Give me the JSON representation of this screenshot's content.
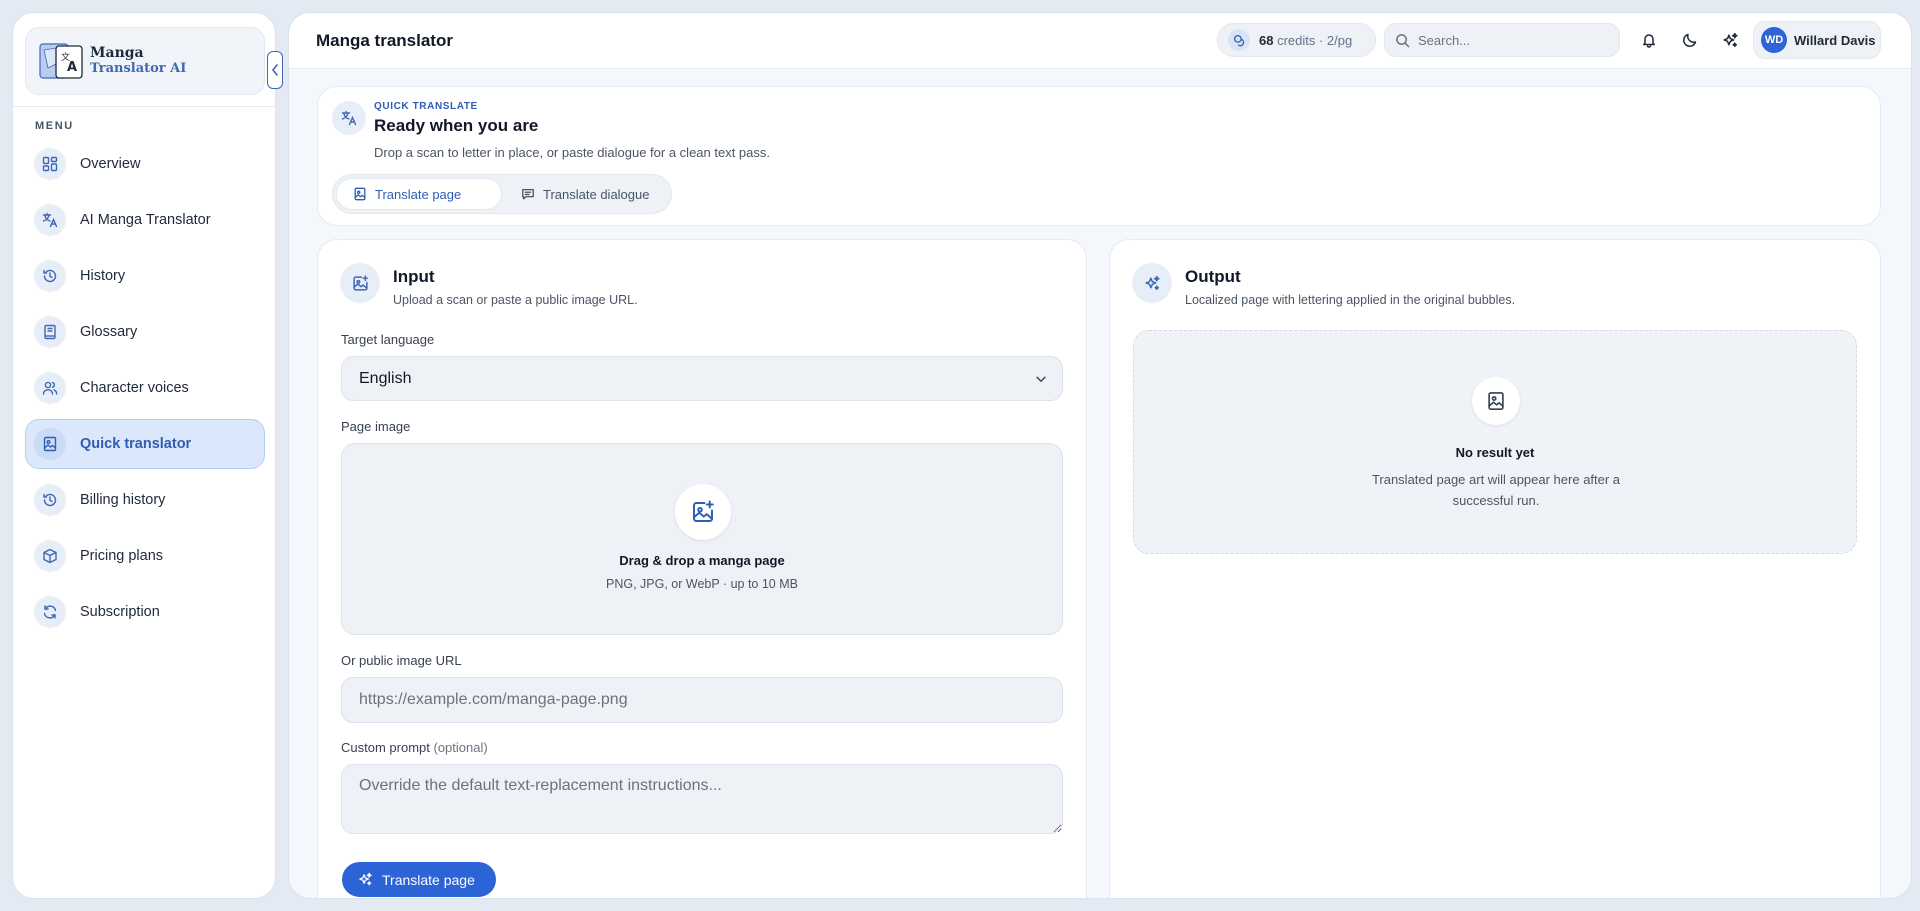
{
  "brand": {
    "line1": "Manga",
    "line2": "Translator AI"
  },
  "sidebar": {
    "menu_label": "MENU",
    "items": [
      {
        "label": "Overview",
        "icon": "grid-icon",
        "active": false
      },
      {
        "label": "AI Manga Translator",
        "icon": "translate-icon",
        "active": false
      },
      {
        "label": "History",
        "icon": "history-icon",
        "active": false
      },
      {
        "label": "Glossary",
        "icon": "book-icon",
        "active": false
      },
      {
        "label": "Character voices",
        "icon": "users-icon",
        "active": false
      },
      {
        "label": "Quick translator",
        "icon": "image-page-icon",
        "active": true
      },
      {
        "label": "Billing history",
        "icon": "history-icon",
        "active": false
      },
      {
        "label": "Pricing plans",
        "icon": "package-icon",
        "active": false
      },
      {
        "label": "Subscription",
        "icon": "refresh-icon",
        "active": false
      }
    ]
  },
  "header": {
    "title": "Manga translator",
    "credits_count": "68",
    "credits_rest": "credits · 2/pg",
    "search_placeholder": "Search...",
    "user_initials": "WD",
    "user_name": "Willard Davis"
  },
  "banner": {
    "eyebrow": "QUICK TRANSLATE",
    "title": "Ready when you are",
    "subtitle": "Drop a scan to letter in place, or paste dialogue for a clean text pass.",
    "tabs": [
      {
        "label": "Translate page",
        "selected": true
      },
      {
        "label": "Translate dialogue",
        "selected": false
      }
    ]
  },
  "input_panel": {
    "title": "Input",
    "subtitle": "Upload a scan or paste a public image URL.",
    "target_language_label": "Target language",
    "target_language_value": "English",
    "page_image_label": "Page image",
    "drop_title": "Drag & drop a manga page",
    "drop_hint": "PNG, JPG, or WebP · up to 10 MB",
    "url_label": "Or public image URL",
    "url_placeholder": "https://example.com/manga-page.png",
    "prompt_label": "Custom prompt",
    "prompt_optional": "(optional)",
    "prompt_placeholder": "Override the default text-replacement instructions...",
    "submit_label": "Translate page"
  },
  "output_panel": {
    "title": "Output",
    "subtitle": "Localized page with lettering applied in the original bubbles.",
    "empty_title": "No result yet",
    "empty_text": "Translated page art will appear here after a successful run."
  },
  "colors": {
    "accent": "#2c63d6",
    "active_bg": "#dbe7fb",
    "page_bg": "#e4eaf3"
  }
}
